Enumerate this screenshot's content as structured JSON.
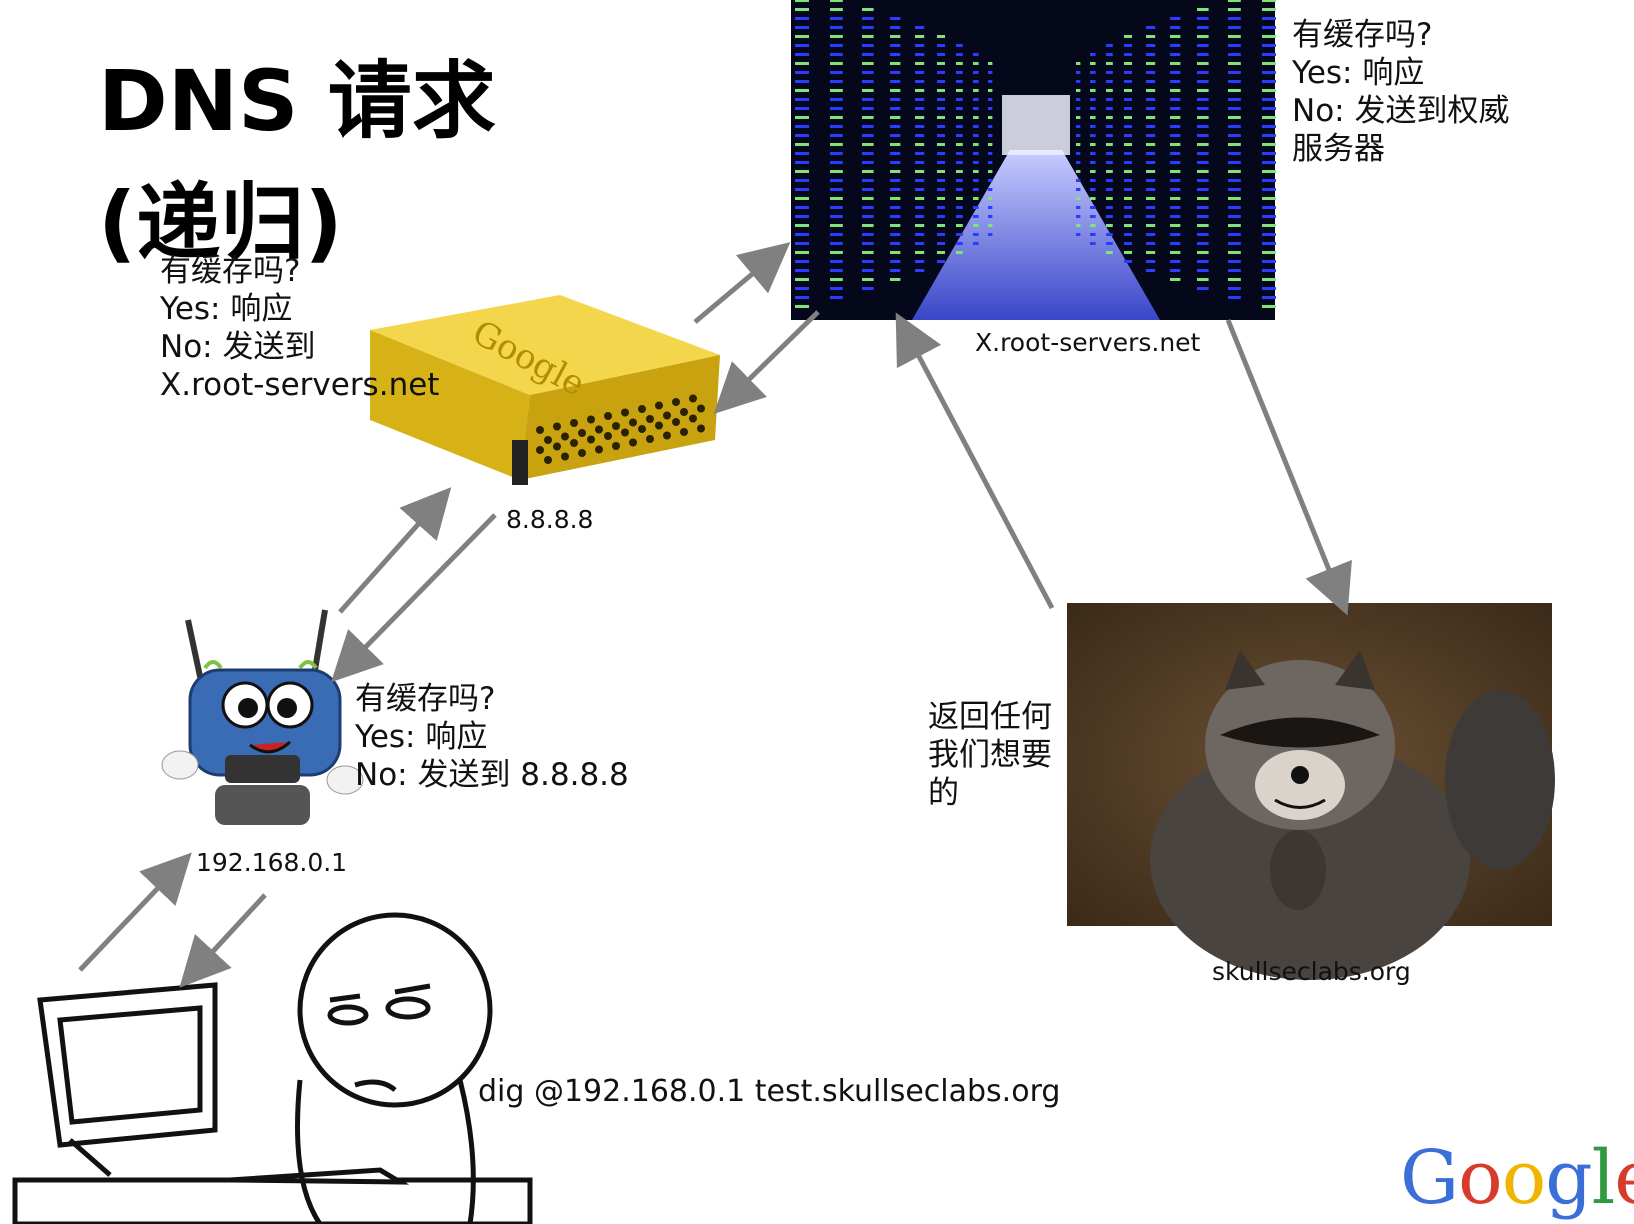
{
  "title": "DNS 请求 (递归)",
  "colors": {
    "arrow": "#808080",
    "server_yellow": "#e8c21a",
    "datacenter_blue": "#2a3cff",
    "datacenter_bg": "#05081a",
    "raccoon_bg": "#5a4630",
    "router_blue": "#3a6bb5"
  },
  "nodes": {
    "client": {
      "command": "dig @192.168.0.1 test.skullseclabs.org"
    },
    "router": {
      "label": "192.168.0.1",
      "note": "有缓存吗?\nYes: 响应\nNo: 发送到 8.8.8.8"
    },
    "resolver": {
      "label": "8.8.8.8",
      "note": "有缓存吗?\nYes: 响应\nNo: 发送到\nX.root-servers.net",
      "logo_text": "Google"
    },
    "root": {
      "label": "X.root-servers.net",
      "note": "有缓存吗?\nYes: 响应\nNo: 发送到权威\n服务器"
    },
    "authority": {
      "label": "skullseclabs.org",
      "note": "返回任何\n我们想要\n的"
    }
  },
  "footer_logo": {
    "letters": [
      {
        "char": "G",
        "color": "#3b6fd8"
      },
      {
        "char": "o",
        "color": "#d83b2b"
      },
      {
        "char": "o",
        "color": "#f0b400"
      },
      {
        "char": "g",
        "color": "#3b6fd8"
      },
      {
        "char": "l",
        "color": "#2f9a3f"
      },
      {
        "char": "e",
        "color": "#d83b2b"
      }
    ]
  }
}
